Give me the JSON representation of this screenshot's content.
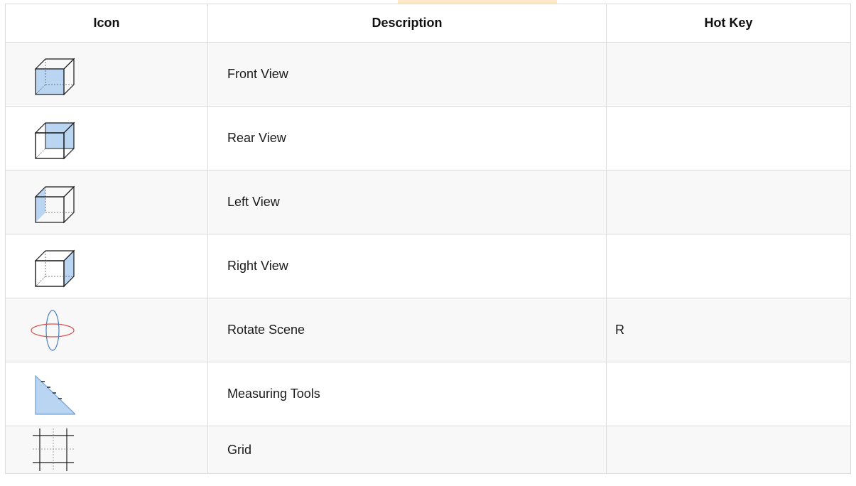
{
  "table": {
    "headers": {
      "icon": "Icon",
      "description": "Description",
      "hotkey": "Hot Key"
    },
    "rows": [
      {
        "icon": "front-view-icon",
        "description": "Front View",
        "hotkey": ""
      },
      {
        "icon": "rear-view-icon",
        "description": "Rear View",
        "hotkey": ""
      },
      {
        "icon": "left-view-icon",
        "description": "Left View",
        "hotkey": ""
      },
      {
        "icon": "right-view-icon",
        "description": "Right View",
        "hotkey": ""
      },
      {
        "icon": "rotate-scene-icon",
        "description": "Rotate Scene",
        "hotkey": "R"
      },
      {
        "icon": "measuring-tools-icon",
        "description": "Measuring Tools",
        "hotkey": ""
      },
      {
        "icon": "grid-icon",
        "description": "Grid",
        "hotkey": ""
      }
    ]
  },
  "colors": {
    "icon_fill": "#b9d5f2",
    "icon_stroke": "#1a1a1a",
    "rotate_red": "#d9534f",
    "rotate_blue": "#4a7fc1",
    "border": "#dcdcdc"
  }
}
